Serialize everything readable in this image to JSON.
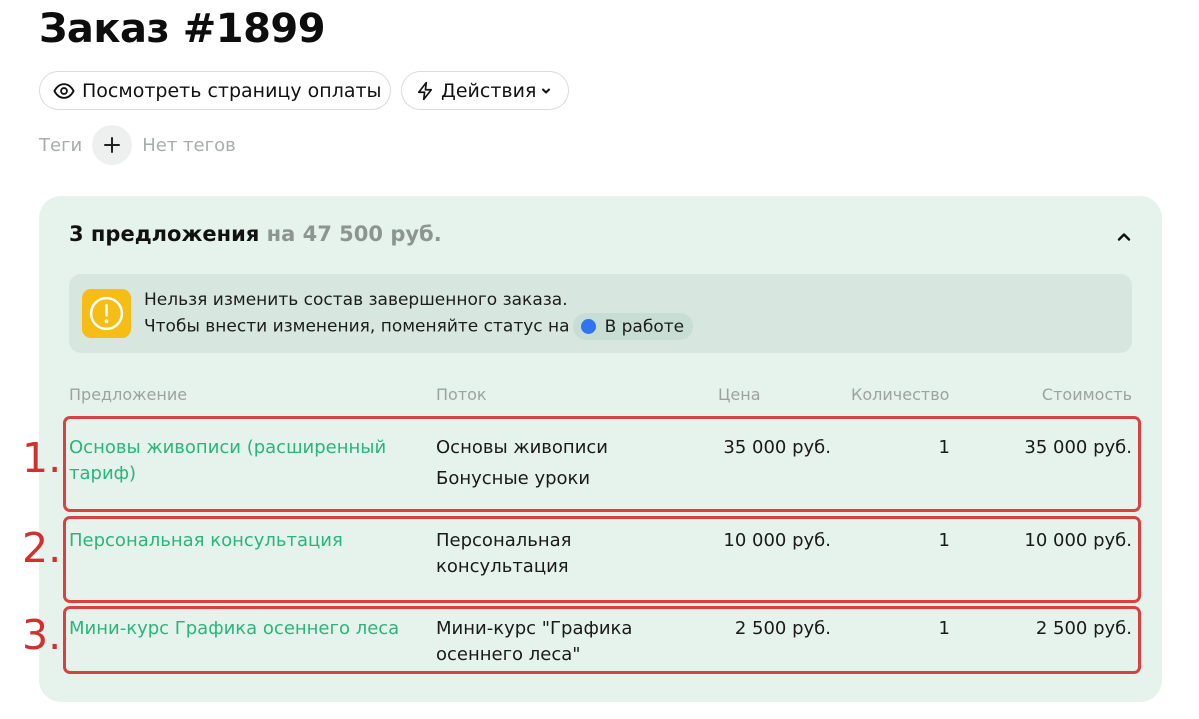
{
  "page": {
    "title": "Заказ #1899"
  },
  "toolbar": {
    "view_payment_label": "Посмотреть страницу оплаты",
    "actions_label": "Действия"
  },
  "tags": {
    "label": "Теги",
    "empty_text": "Нет тегов"
  },
  "offers": {
    "count_text": "3 предложения",
    "total_text": "на 47 500 руб.",
    "alert": {
      "line1": "Нельзя изменить состав завершенного заказа.",
      "line2": "Чтобы внести изменения, поменяйте статус на",
      "status_label": "В работе",
      "status_color": "#2f74f3",
      "icon_color": "#f6bd17"
    },
    "columns": {
      "offer": "Предложение",
      "stream": "Поток",
      "price": "Цена",
      "quantity": "Количество",
      "cost": "Стоимость"
    },
    "rows": [
      {
        "number": "1.",
        "offer": "Основы живописи (расширенный тариф)",
        "streams": [
          "Основы живописи",
          "Бонусные уроки"
        ],
        "price": "35 000 руб.",
        "quantity": "1",
        "cost": "35 000 руб."
      },
      {
        "number": "2.",
        "offer": "Персональная консультация",
        "streams": [
          "Персональная консультация"
        ],
        "price": "10 000 руб.",
        "quantity": "1",
        "cost": "10 000 руб."
      },
      {
        "number": "3.",
        "offer": "Мини-курс Графика осеннего леса",
        "streams": [
          "Мини-курс \"Графика осеннего леса\""
        ],
        "price": "2 500 руб.",
        "quantity": "1",
        "cost": "2 500 руб."
      }
    ]
  },
  "colors": {
    "accent_green": "#2bb47c",
    "highlight_red": "#d94140",
    "card_bg": "#e5f3ec"
  }
}
